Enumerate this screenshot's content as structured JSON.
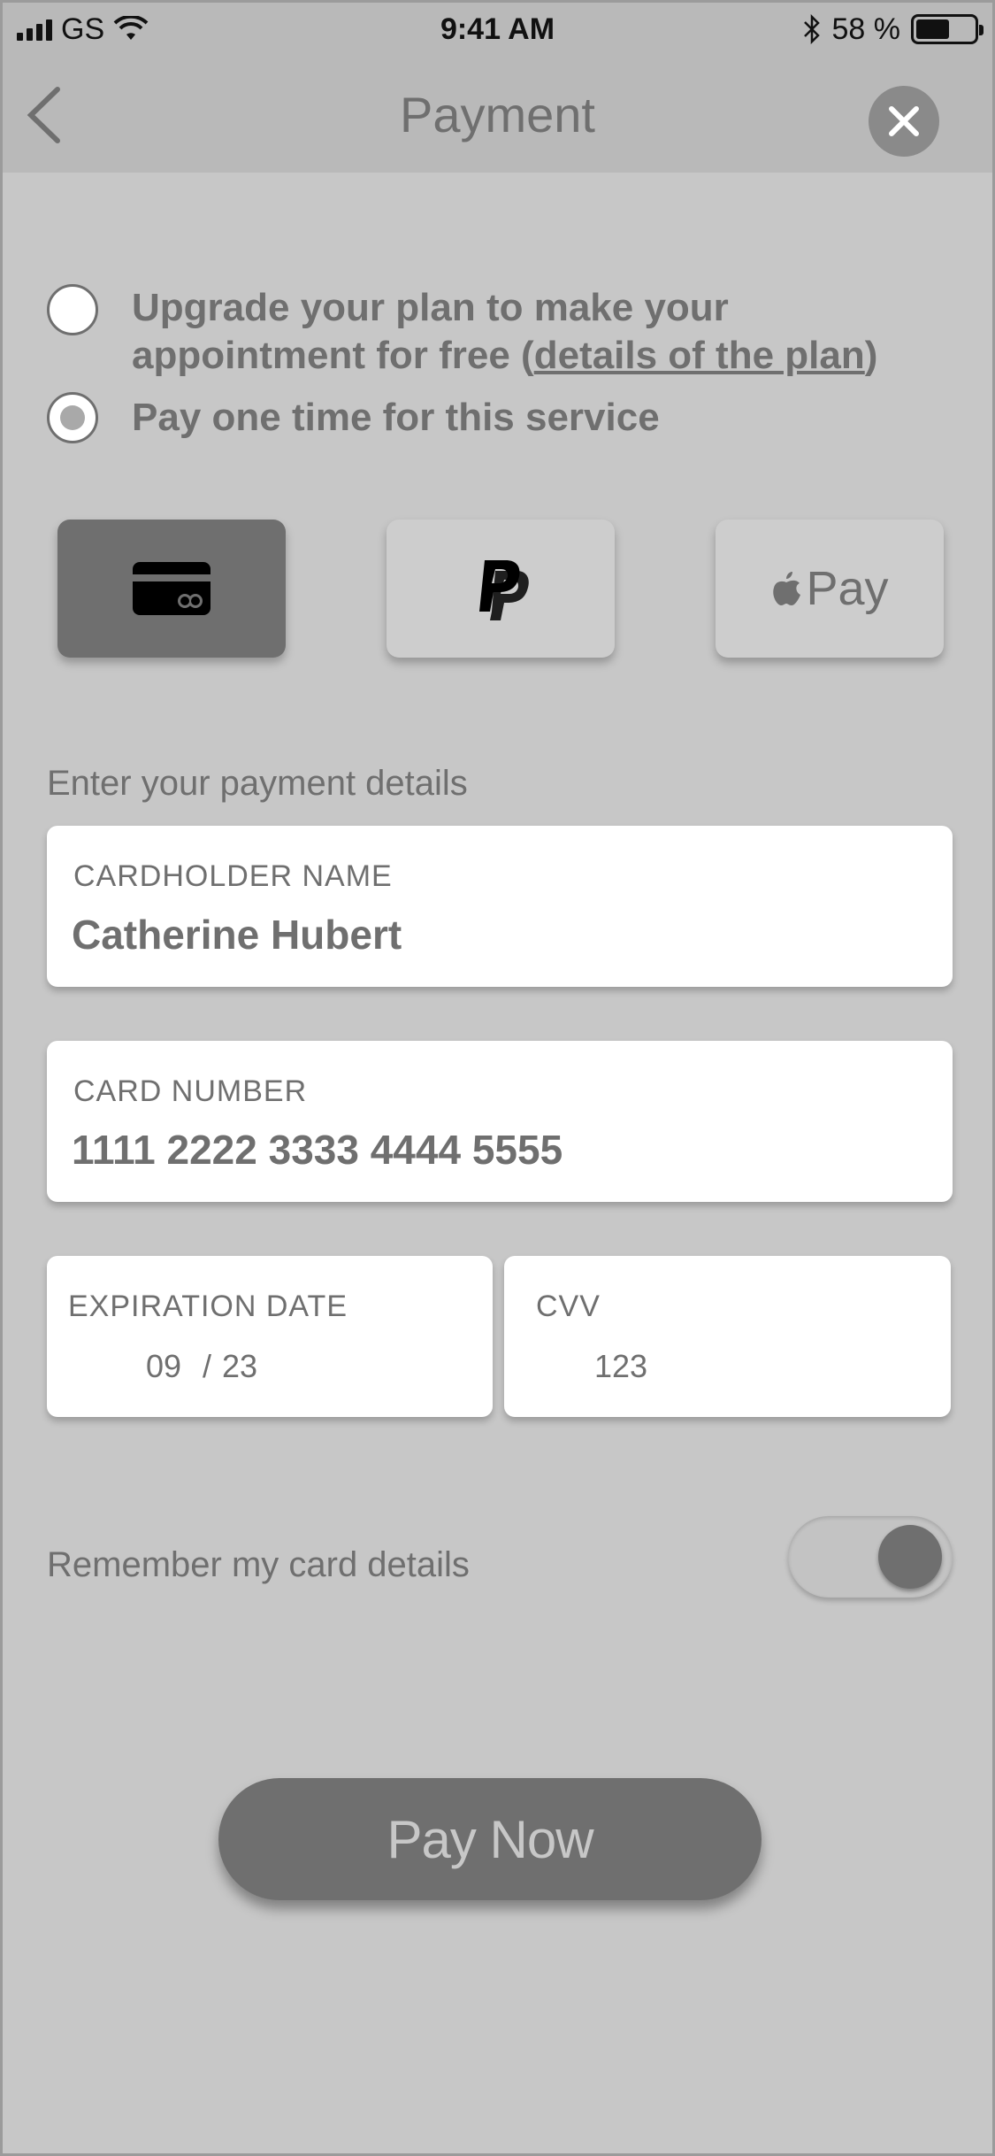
{
  "status_bar": {
    "carrier": "GS",
    "time": "9:41 AM",
    "battery": "58 %",
    "battery_level": 0.58
  },
  "nav": {
    "title": "Payment"
  },
  "options": {
    "upgrade_line1": "Upgrade your plan to make your",
    "upgrade_line2_prefix": "appointment for free (",
    "upgrade_link": "details of the plan",
    "upgrade_line2_suffix": ")",
    "one_time": "Pay one time for this service",
    "selected": "one_time"
  },
  "methods": {
    "items": [
      "card",
      "paypal",
      "apple-pay"
    ],
    "selected": "card",
    "applepay_text": "Pay"
  },
  "form": {
    "section_label": "Enter your payment details",
    "cardholder_label": "CARDHOLDER NAME",
    "cardholder_value": "Catherine Hubert",
    "card_number_label": "CARD NUMBER",
    "card_number_value": "1111 2222 3333 4444 5555",
    "expiration_label": "EXPIRATION DATE",
    "expiration_month": "09",
    "expiration_sep": "/",
    "expiration_year": "23",
    "cvv_label": "CVV",
    "cvv_value": "123"
  },
  "remember": {
    "label": "Remember my card details",
    "enabled": true
  },
  "pay_button": {
    "label": "Pay Now"
  },
  "colors": {
    "background": "#c7c7c7",
    "header": "#b9b9b9",
    "accent": "#6f6f6f",
    "field": "#ffffff"
  }
}
